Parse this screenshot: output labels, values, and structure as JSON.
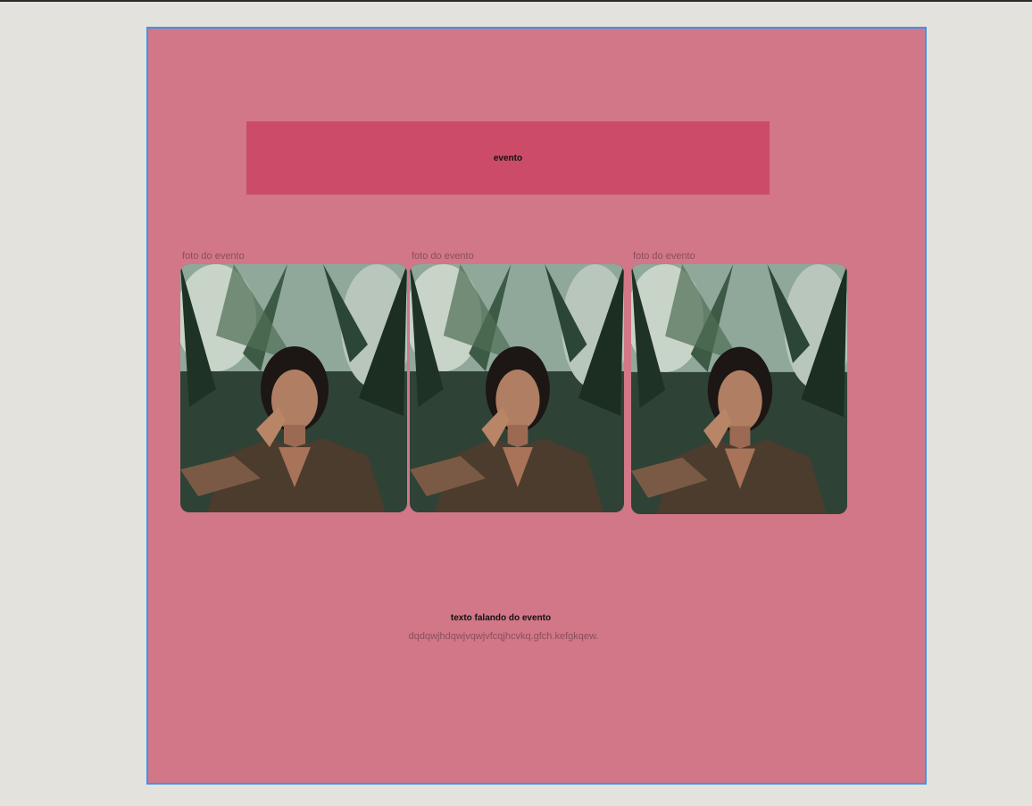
{
  "event": {
    "banner_label": "evento",
    "photos": [
      {
        "label": "foto do evento",
        "image": "portrait-woman-in-plaid-blazer-among-palm-leaves"
      },
      {
        "label": "foto do evento",
        "image": "portrait-woman-in-plaid-blazer-among-palm-leaves"
      },
      {
        "label": "foto do evento",
        "image": "portrait-woman-in-plaid-blazer-among-palm-leaves"
      }
    ],
    "description_title": "texto falando do evento",
    "description_body": "dqdqwjhdqwjvqwjvfcqjhcvkq.gfch.kefgkqew."
  },
  "colors": {
    "canvas": "#e3e2dc",
    "frame": "#d17787",
    "frame_selection": "#3b95ee",
    "banner": "#cc4b69"
  }
}
